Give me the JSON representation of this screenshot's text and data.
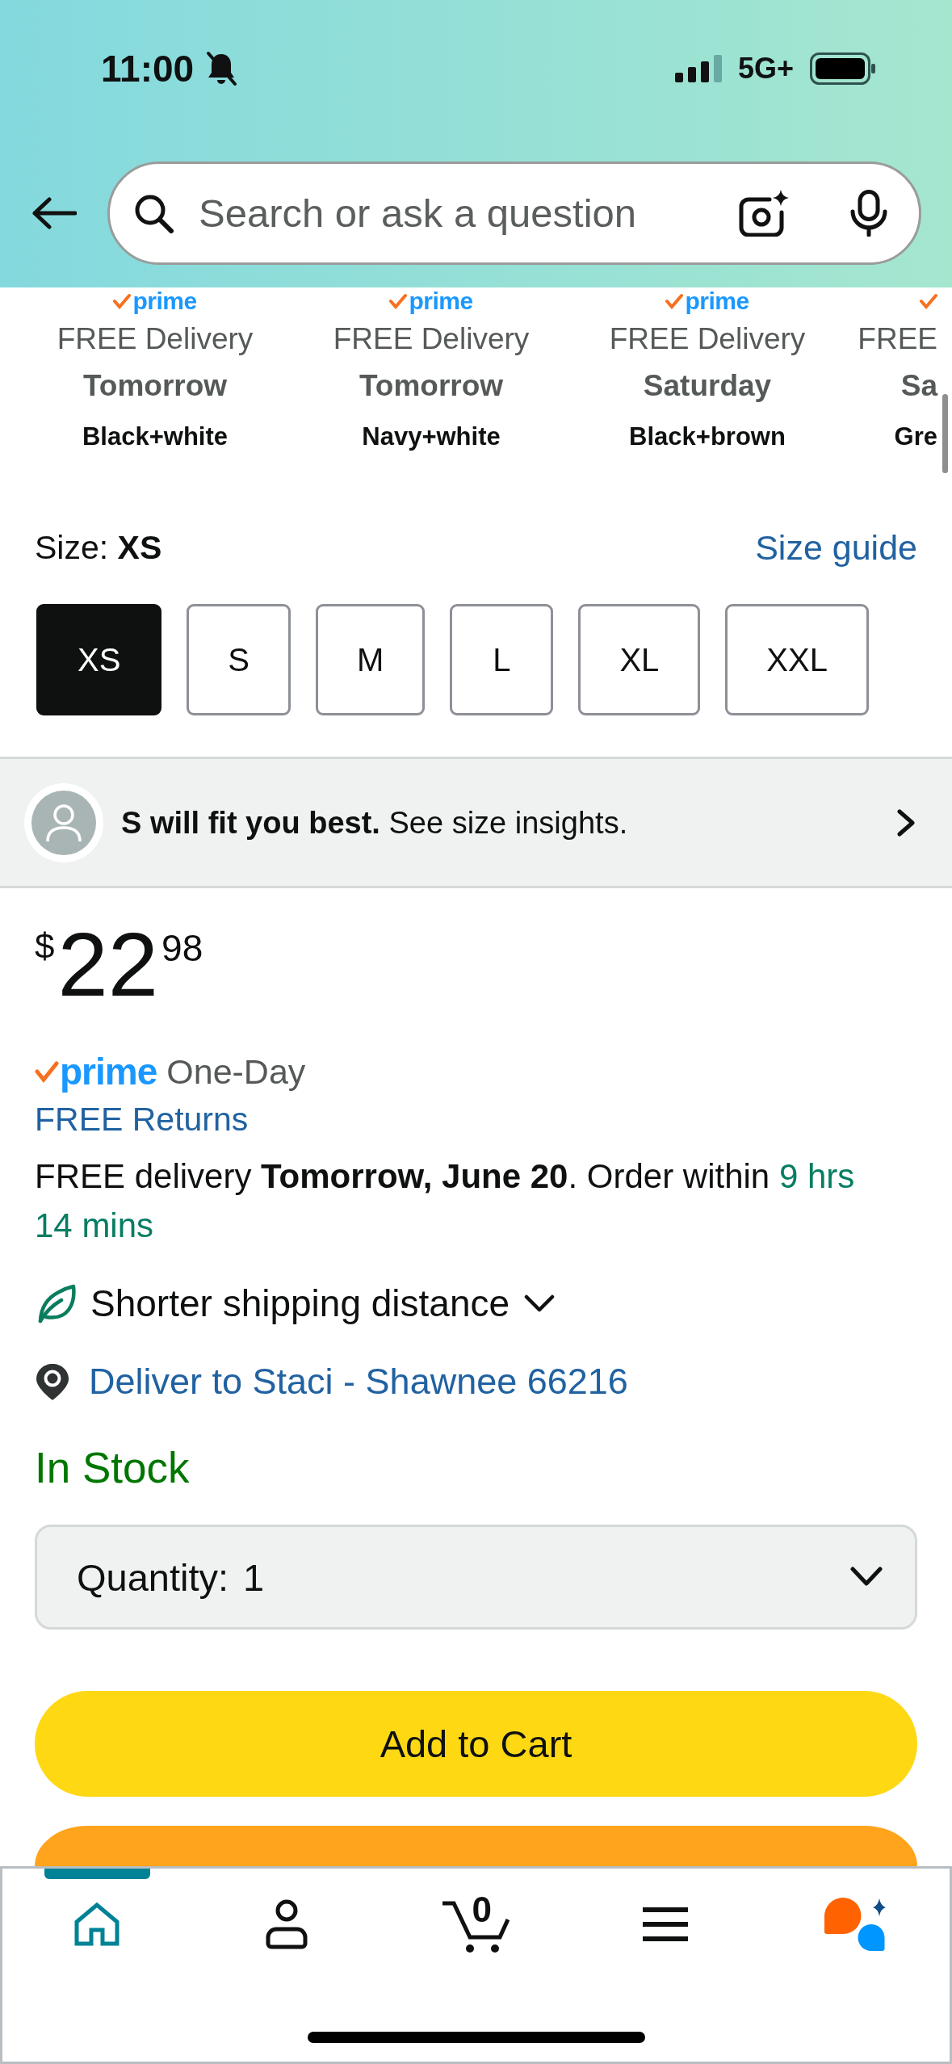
{
  "status_bar": {
    "time": "11:00",
    "ringer_muted": true,
    "network": "5G+"
  },
  "search": {
    "placeholder": "Search or ask a question"
  },
  "variants": [
    {
      "badge": "prime",
      "delivery": "FREE Delivery",
      "day": "Tomorrow",
      "color_name": "Black+white"
    },
    {
      "badge": "prime",
      "delivery": "FREE Delivery",
      "day": "Tomorrow",
      "color_name": "Navy+white"
    },
    {
      "badge": "prime",
      "delivery": "FREE Delivery",
      "day": "Saturday",
      "color_name": "Black+brown"
    },
    {
      "delivery": "FREE",
      "day": "Sa",
      "color_name": "Gre"
    }
  ],
  "size": {
    "label": "Size:",
    "value": "XS",
    "guide_link": "Size guide",
    "options": [
      {
        "label": "XS",
        "selected": true
      },
      {
        "label": "S",
        "selected": false
      },
      {
        "label": "M",
        "selected": false
      },
      {
        "label": "L",
        "selected": false
      },
      {
        "label": "XL",
        "selected": false
      },
      {
        "label": "XXL",
        "selected": false
      }
    ]
  },
  "fit_banner": {
    "text": "**S will fit you best.** See size insights."
  },
  "price": {
    "currency": "$",
    "whole": "22",
    "fraction": "98"
  },
  "prime_delivery": {
    "badge": "prime",
    "speed": "One-Day"
  },
  "returns_link": "FREE Returns",
  "delivery": {
    "text": "FREE delivery **Tomorrow, June 20**. Order within",
    "countdown": "9 hrs 14 mins"
  },
  "shipping_note": {
    "text": "Shorter shipping distance",
    "expanded": false
  },
  "deliver_to": "Deliver to Staci - Shawnee 66216",
  "stock": "In Stock",
  "quantity": {
    "label": "Quantity:",
    "value": "1"
  },
  "buttons": [
    {
      "kind": "primary",
      "label": "Add to Cart"
    },
    {
      "kind": "secondary"
    }
  ],
  "tab_bar": {
    "tabs": [
      {
        "kind": "home",
        "selected": true
      },
      {
        "kind": "account",
        "selected": false
      },
      {
        "kind": "cart",
        "selected": false,
        "count": "0"
      },
      {
        "kind": "menu",
        "selected": false
      },
      {
        "kind": "assistant",
        "selected": false
      }
    ]
  }
}
